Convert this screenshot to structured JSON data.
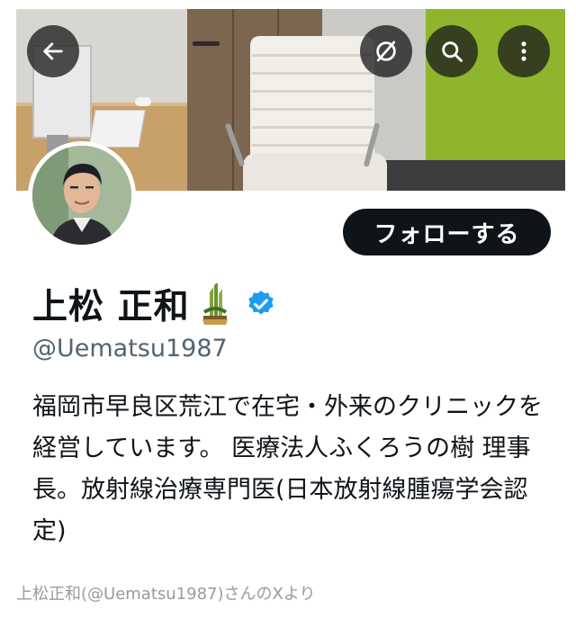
{
  "profile": {
    "display_name": "上松 正和",
    "handle": "@Uematsu1987",
    "verified": true,
    "bio": "福岡市早良区荒江で在宅・外来のクリニックを経営しています。 医療法人ふくろうの樹 理事長。放射線治療専門医(日本放射線腫瘍学会認定)",
    "name_badges": [
      "kadomatsu-emoji",
      "verified-badge-icon"
    ]
  },
  "header_actions": {
    "back_icon": "back-arrow-icon",
    "unmute_icon": "slashed-circle-icon",
    "search_icon": "search-icon",
    "more_icon": "more-vertical-icon"
  },
  "follow_button": {
    "label": "フォローする"
  },
  "caption": "上松正和(@Uematsu1987)さんのXより",
  "colors": {
    "verified_blue": "#1d9bf0",
    "button_black": "#0f1419",
    "handle_gray": "#536471",
    "green_wall": "#8fb52c"
  }
}
